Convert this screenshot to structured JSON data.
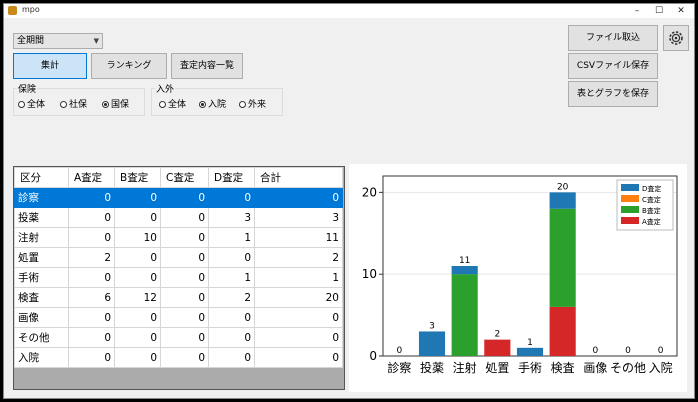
{
  "window": {
    "title": "mpo"
  },
  "period_select": {
    "value": "全期間"
  },
  "buttons": {
    "aggregate": "集計",
    "ranking": "ランキング",
    "review_list": "査定内容一覧",
    "import_file": "ファイル取込",
    "save_csv": "CSVファイル保存",
    "save_table_graph": "表とグラフを保存"
  },
  "insurance_filter": {
    "label": "保険",
    "options": [
      "全体",
      "社保",
      "国保"
    ],
    "selected": "国保"
  },
  "inout_filter": {
    "label": "入外",
    "options": [
      "全体",
      "入院",
      "外来"
    ],
    "selected": "入院"
  },
  "table": {
    "columns": [
      "区分",
      "A査定",
      "B査定",
      "C査定",
      "D査定",
      "合計"
    ],
    "rows": [
      [
        "診察",
        "0",
        "0",
        "0",
        "0",
        "0"
      ],
      [
        "投薬",
        "0",
        "0",
        "0",
        "3",
        "3"
      ],
      [
        "注射",
        "0",
        "10",
        "0",
        "1",
        "11"
      ],
      [
        "処置",
        "2",
        "0",
        "0",
        "0",
        "2"
      ],
      [
        "手術",
        "0",
        "0",
        "0",
        "1",
        "1"
      ],
      [
        "検査",
        "6",
        "12",
        "0",
        "2",
        "20"
      ],
      [
        "画像",
        "0",
        "0",
        "0",
        "0",
        "0"
      ],
      [
        "その他",
        "0",
        "0",
        "0",
        "0",
        "0"
      ],
      [
        "入院",
        "0",
        "0",
        "0",
        "0",
        "0"
      ]
    ],
    "selected_row": 0
  },
  "chart_data": {
    "type": "bar",
    "stacked": true,
    "categories": [
      "診察",
      "投薬",
      "注射",
      "処置",
      "手術",
      "検査",
      "画像",
      "その他",
      "入院"
    ],
    "series": [
      {
        "name": "A査定",
        "color": "#d62728",
        "values": [
          0,
          0,
          0,
          2,
          0,
          6,
          0,
          0,
          0
        ]
      },
      {
        "name": "B査定",
        "color": "#2ca02c",
        "values": [
          0,
          0,
          10,
          0,
          0,
          12,
          0,
          0,
          0
        ]
      },
      {
        "name": "C査定",
        "color": "#ff7f0e",
        "values": [
          0,
          0,
          0,
          0,
          0,
          0,
          0,
          0,
          0
        ]
      },
      {
        "name": "D査定",
        "color": "#1f77b4",
        "values": [
          0,
          3,
          1,
          0,
          1,
          2,
          0,
          0,
          0
        ]
      }
    ],
    "totals": [
      0,
      3,
      11,
      2,
      1,
      20,
      0,
      0,
      0
    ],
    "yticks": [
      0,
      10,
      20
    ],
    "ylim": [
      0,
      22
    ],
    "legend": "top-right",
    "grid": true
  }
}
